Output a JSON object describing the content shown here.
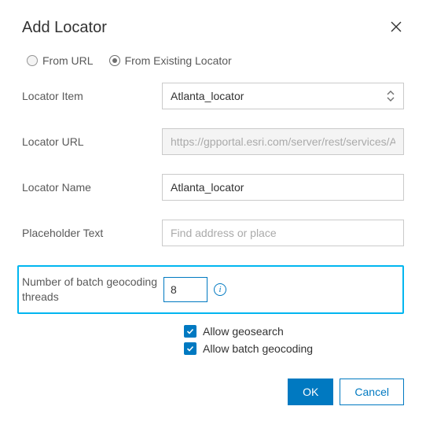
{
  "title": "Add Locator",
  "source": {
    "from_url_label": "From URL",
    "from_existing_label": "From Existing Locator",
    "selected": "existing"
  },
  "fields": {
    "locator_item": {
      "label": "Locator Item",
      "value": "Atlanta_locator"
    },
    "locator_url": {
      "label": "Locator URL",
      "placeholder": "https://gpportal.esri.com/server/rest/services/Atl"
    },
    "locator_name": {
      "label": "Locator Name",
      "value": "Atlanta_locator"
    },
    "placeholder_text": {
      "label": "Placeholder Text",
      "placeholder": "Find address or place"
    },
    "batch_threads": {
      "label": "Number of batch geocoding threads",
      "value": "8"
    }
  },
  "options": {
    "allow_geosearch": {
      "label": "Allow geosearch",
      "checked": true
    },
    "allow_batch": {
      "label": "Allow batch geocoding",
      "checked": true
    }
  },
  "buttons": {
    "ok": "OK",
    "cancel": "Cancel"
  },
  "colors": {
    "accent": "#0079c1",
    "highlight": "#00b6f0"
  }
}
